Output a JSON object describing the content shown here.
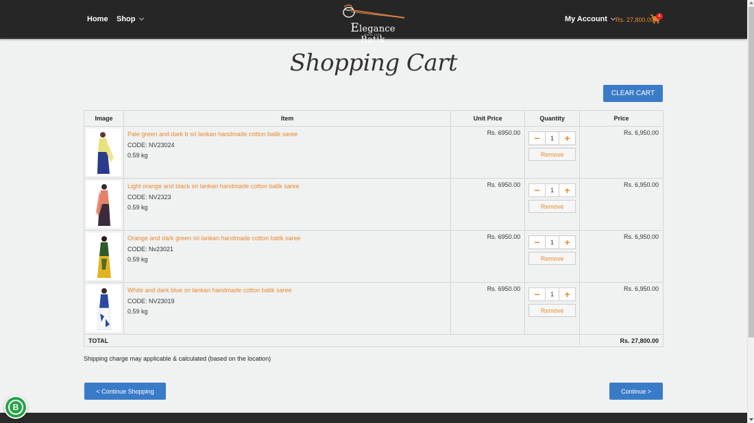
{
  "header": {
    "nav_home": "Home",
    "nav_shop": "Shop",
    "logo_name": "Elegance Batik",
    "logo_since": "Since 1976",
    "my_account": "My Account",
    "cart_total": "Rs. 27,800.00",
    "cart_count": "4"
  },
  "page": {
    "title": "Shopping Cart",
    "clear_cart": "CLEAR CART"
  },
  "table": {
    "headers": [
      "Image",
      "Item",
      "Unit Price",
      "Quantity",
      "Price"
    ],
    "items": [
      {
        "name": "Pale green and dark b sri lankan handmade cotton batik saree",
        "code": "CODE: NV23024",
        "weight": "0.59 kg",
        "unit_price": "Rs. 6950.00",
        "quantity": "1",
        "price": "Rs. 6,950.00",
        "remove": "Remove",
        "colors": [
          "#e9e27c",
          "#2a3a8c"
        ]
      },
      {
        "name": "Light orange and black sri lankan handmade cotton batik saree",
        "code": "CODE: NV2323",
        "weight": "0.59 kg",
        "unit_price": "Rs. 6950.00",
        "quantity": "1",
        "price": "Rs. 6,950.00",
        "remove": "Remove",
        "colors": [
          "#e5826a",
          "#3a2a3a"
        ]
      },
      {
        "name": "Orange and dark green sri lankan handmade cotton batik saree",
        "code": "CODE: Nv23021",
        "weight": "0.59 kg",
        "unit_price": "Rs. 6950.00",
        "quantity": "1",
        "price": "Rs. 6,950.00",
        "remove": "Remove",
        "colors": [
          "#e0b420",
          "#2e5a2a"
        ]
      },
      {
        "name": "White and dark blue sri lankan handmade cotton batik saree",
        "code": "CODE: NV23019",
        "weight": "0.59 kg",
        "unit_price": "Rs. 6950.00",
        "quantity": "1",
        "price": "Rs. 6,950.00",
        "remove": "Remove",
        "colors": [
          "#f4f6fa",
          "#2a4aa0"
        ]
      }
    ],
    "total_label": "TOTAL",
    "total_value": "Rs. 27,800.00"
  },
  "footer": {
    "shipping_note": "Shipping charge may applicable & calculated (based on the location)",
    "continue_shopping": "< Continue Shopping",
    "continue": "Continue >",
    "chat_letter": "B"
  },
  "colors": {
    "accent": "#e88a2e",
    "button_blue": "#3a7bc8",
    "header_bg": "#262626",
    "whatsapp_green": "#25a24a"
  }
}
